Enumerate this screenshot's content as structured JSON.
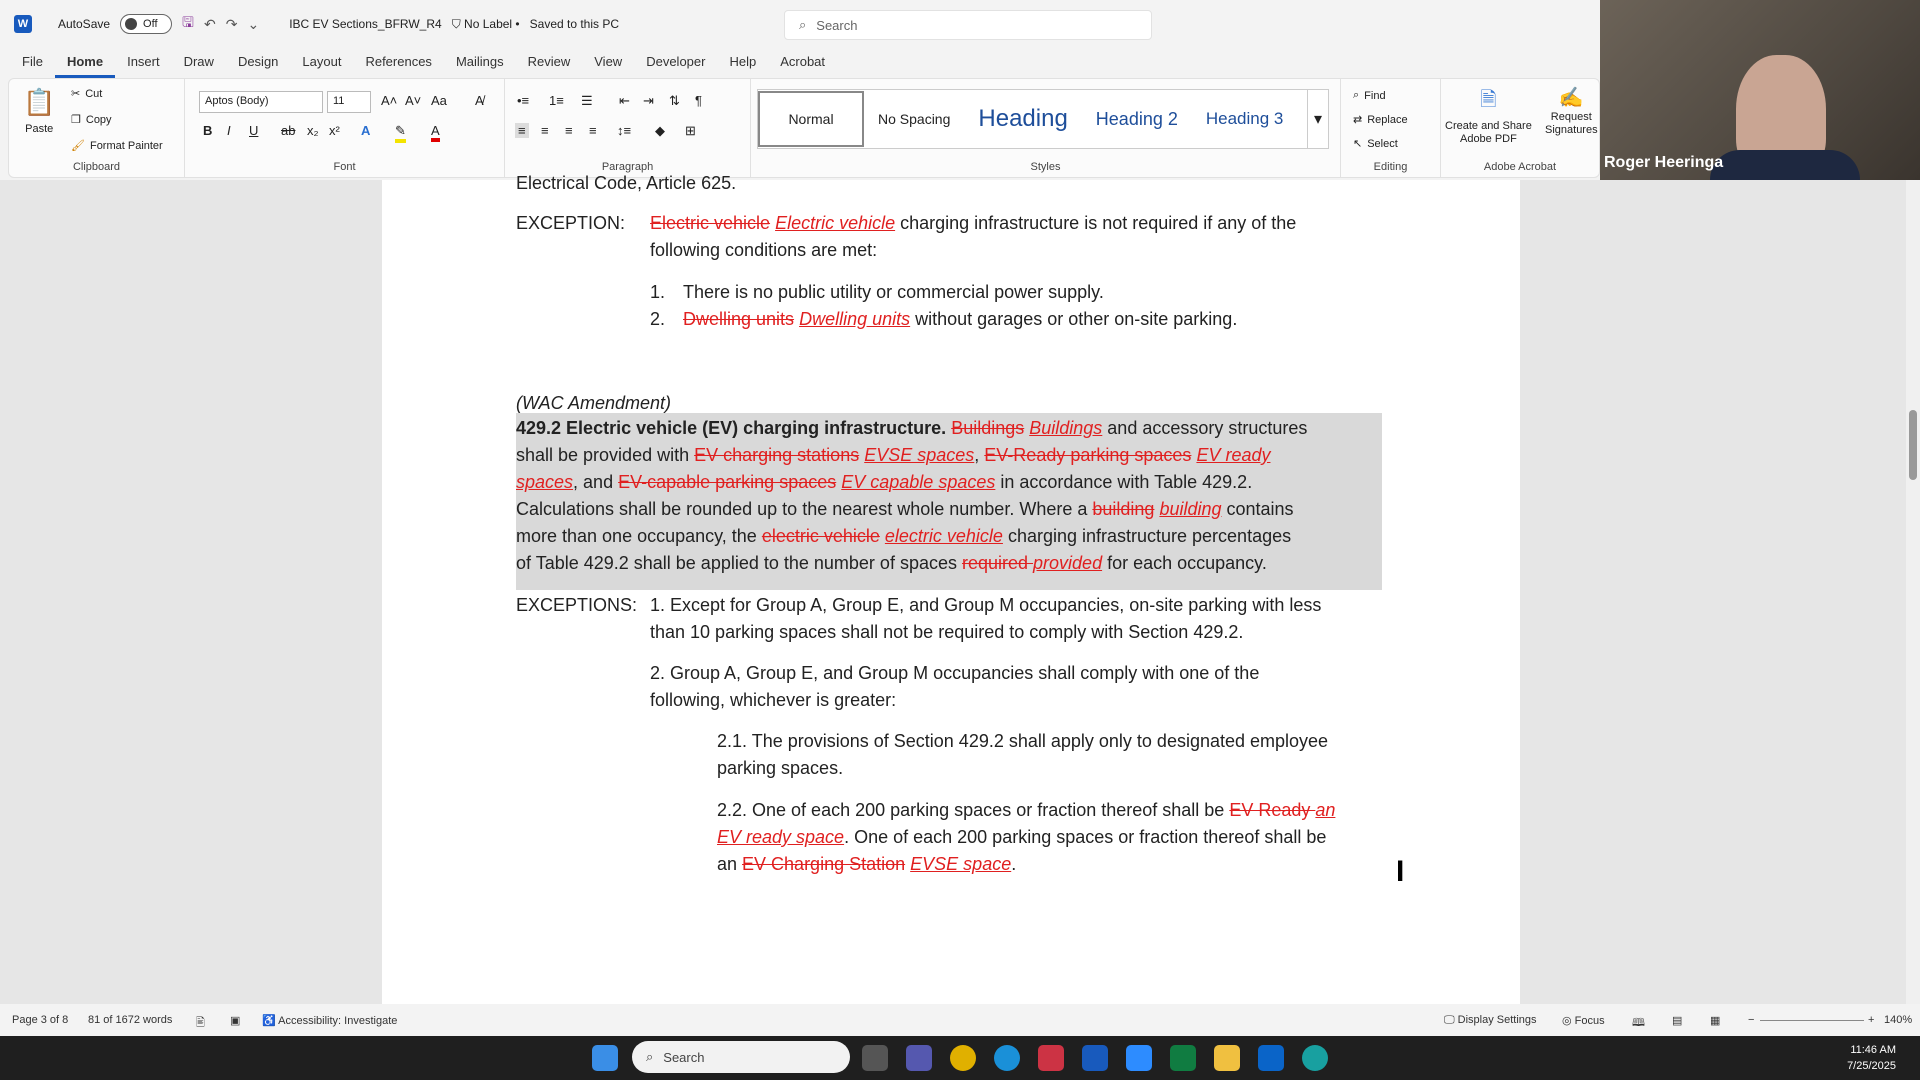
{
  "titlebar": {
    "autosave_label": "AutoSave",
    "autosave_state": "Off",
    "doc_title": "IBC EV Sections_BFRW_R4",
    "label_status": "No Label",
    "save_status": "Saved to this PC",
    "search_placeholder": "Search"
  },
  "tabs": [
    "File",
    "Home",
    "Insert",
    "Draw",
    "Design",
    "Layout",
    "References",
    "Mailings",
    "Review",
    "View",
    "Developer",
    "Help",
    "Acrobat"
  ],
  "ribbon": {
    "clipboard": {
      "paste": "Paste",
      "cut": "Cut",
      "copy": "Copy",
      "format_painter": "Format Painter",
      "label": "Clipboard"
    },
    "font": {
      "family": "Aptos (Body)",
      "size": "11",
      "label": "Font"
    },
    "paragraph": {
      "label": "Paragraph"
    },
    "styles": {
      "label": "Styles",
      "items": [
        "Normal",
        "No Spacing",
        "Heading",
        "Heading 2",
        "Heading 3"
      ]
    },
    "editing": {
      "find": "Find",
      "replace": "Replace",
      "select": "Select",
      "label": "Editing"
    },
    "acrobat": {
      "create": "Create and Share",
      "create2": "Adobe PDF",
      "request": "Request",
      "request2": "Signatures",
      "label": "Adobe Acrobat"
    }
  },
  "video": {
    "name": "Roger Heeringa"
  },
  "document": {
    "l0": "Electrical Code, Article 625.",
    "exc1_label": "EXCEPTION:",
    "exc1_del": "Electric vehicle",
    "exc1_ins": "Electric vehicle",
    "exc1_rest": " charging infrastructure is not required if any of the",
    "exc1_line2": "following conditions are met:",
    "item1_num": "1.",
    "item1": "There is no public utility or commercial power supply.",
    "item2_num": "2.",
    "item2_del": "Dwelling units",
    "item2_ins": "Dwelling units",
    "item2_rest": " without garages or other on-site parking.",
    "wac": "(WAC Amendment)",
    "p_head": "429.2 Electric vehicle (EV) charging infrastructure.",
    "p1_del": "Buildings",
    "p1_ins": "Buildings",
    "p1_rest": " and accessory structures",
    "p2_a": "shall be provided with ",
    "p2_del1": "EV charging stations",
    "p2_ins1": "EVSE spaces",
    "p2_b": ", ",
    "p2_del2": "EV-Ready parking spaces",
    "p2_ins2": "EV ready",
    "p3_ins": "spaces",
    "p3_a": ", and ",
    "p3_del": "EV-capable parking spaces",
    "p3_ins2": "EV capable spaces",
    "p3_rest": " in accordance with Table 429.2.",
    "p4_a": "Calculations shall be rounded up to the nearest whole number. Where a ",
    "p4_del": "building",
    "p4_ins": "building",
    "p4_rest": " contains",
    "p5_a": "more than one occupancy, the ",
    "p5_del": "electric vehicle",
    "p5_ins": "electric vehicle",
    "p5_rest": " charging infrastructure percentages",
    "p6_a": "of Table 429.2 shall be applied to the number of spaces ",
    "p6_del": "required ",
    "p6_ins": "provided",
    "p6_rest": " for each occupancy.",
    "excs_label": "EXCEPTIONS:",
    "e1_l1": "1. Except for Group A, Group E, and Group M occupancies, on-site parking with less",
    "e1_l2": "than 10 parking spaces shall not be required to comply with Section 429.2.",
    "e2_l1": "2. Group A, Group E, and Group M occupancies shall comply with one of the",
    "e2_l2": "following, whichever is greater:",
    "e21_l1": "2.1. The provisions of Section 429.2 shall apply only to designated employee",
    "e21_l2": "parking spaces.",
    "e22_a": "2.2. One of each 200 parking spaces or fraction thereof shall be ",
    "e22_del": "EV Ready ",
    "e22_ins": "an",
    "e22_l2_ins": "EV ready space",
    "e22_l2_rest": ". One of each 200 parking spaces or fraction thereof shall be",
    "e22_l3_a": "an ",
    "e22_l3_del": "EV Charging Station",
    "e22_l3_ins": "EVSE space",
    "e22_l3_rest": "."
  },
  "status": {
    "page": "Page 3 of 8",
    "words": "81 of 1672 words",
    "accessibility": "Accessibility: Investigate",
    "display": "Display Settings",
    "focus": "Focus",
    "zoom": "140%"
  },
  "taskbar": {
    "search": "Search",
    "time": "11:46 AM",
    "date": "7/25/2025"
  }
}
